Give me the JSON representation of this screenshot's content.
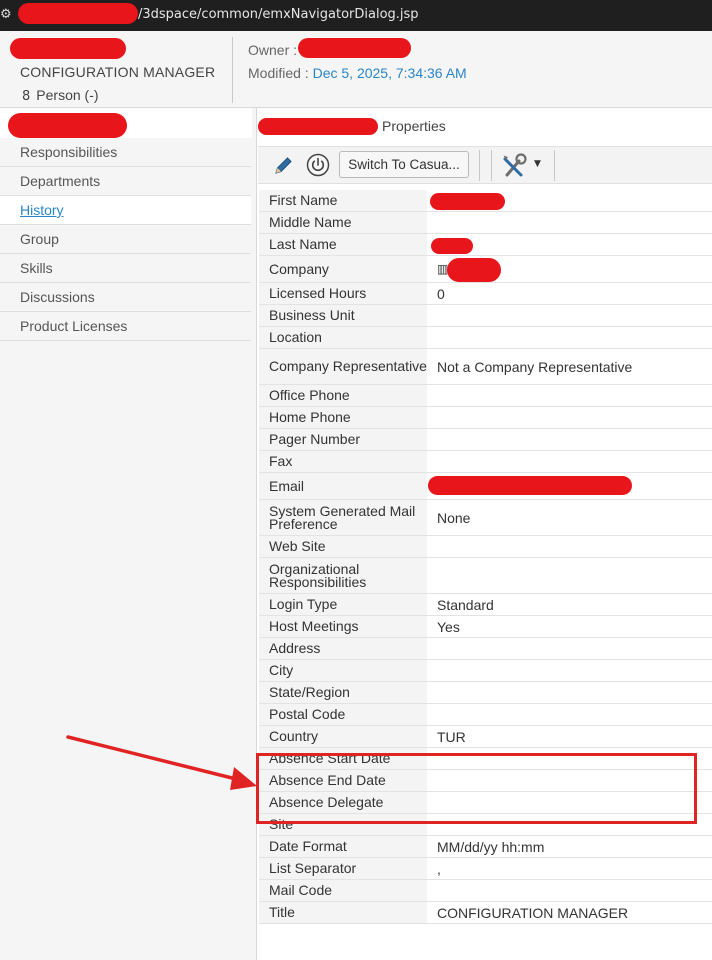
{
  "url_bar": {
    "url": "/3dspace/common/emxNavigatorDialog.jsp"
  },
  "header": {
    "title": "CONFIGURATION MANAGER",
    "type_label": "Person (-)",
    "owner_label": "Owner :",
    "modified_label": "Modified :",
    "modified_value": "Dec 5, 2025, 7:34:36 AM"
  },
  "left_nav": {
    "items": [
      {
        "label": "Responsibilities"
      },
      {
        "label": "Departments"
      },
      {
        "label": "History"
      },
      {
        "label": "Group"
      },
      {
        "label": "Skills"
      },
      {
        "label": "Discussions"
      },
      {
        "label": "Product Licenses"
      }
    ],
    "active_item": "History"
  },
  "main": {
    "title": "Properties",
    "toolbar": {
      "switch_button": "Switch To Casua...",
      "icons": [
        "pencil-icon",
        "power-icon",
        "tools-icon"
      ]
    },
    "properties": [
      {
        "label": "First Name",
        "value": ""
      },
      {
        "label": "Middle Name",
        "value": ""
      },
      {
        "label": "Last Name",
        "value": ""
      },
      {
        "label": "Company",
        "value": ""
      },
      {
        "label": "Licensed Hours",
        "value": "0"
      },
      {
        "label": "Business Unit",
        "value": ""
      },
      {
        "label": "Location",
        "value": ""
      },
      {
        "label": "Company Representative",
        "value": "Not a Company Representative"
      },
      {
        "label": "Office Phone",
        "value": ""
      },
      {
        "label": "Home Phone",
        "value": ""
      },
      {
        "label": "Pager Number",
        "value": ""
      },
      {
        "label": "Fax",
        "value": ""
      },
      {
        "label": "Email",
        "value": ""
      },
      {
        "label": "System Generated Mail Preference",
        "value": "None"
      },
      {
        "label": "Web Site",
        "value": ""
      },
      {
        "label": "Organizational Responsibilities",
        "value": ""
      },
      {
        "label": "Login Type",
        "value": "Standard"
      },
      {
        "label": "Host Meetings",
        "value": "Yes"
      },
      {
        "label": "Address",
        "value": ""
      },
      {
        "label": "City",
        "value": ""
      },
      {
        "label": "State/Region",
        "value": ""
      },
      {
        "label": "Postal Code",
        "value": ""
      },
      {
        "label": "Country",
        "value": "TUR"
      },
      {
        "label": "Absence Start Date",
        "value": ""
      },
      {
        "label": "Absence End Date",
        "value": ""
      },
      {
        "label": "Absence Delegate",
        "value": ""
      },
      {
        "label": "Site",
        "value": ""
      },
      {
        "label": "Date Format",
        "value": "MM/dd/yy hh:mm"
      },
      {
        "label": "List Separator",
        "value": ","
      },
      {
        "label": "Mail Code",
        "value": ""
      },
      {
        "label": "Title",
        "value": "CONFIGURATION MANAGER"
      }
    ]
  },
  "annotation": {
    "color": "#e02424",
    "highlighted": [
      "Absence Start Date",
      "Absence End Date",
      "Absence Delegate"
    ]
  },
  "colors": {
    "link": "#2a85c8",
    "redaction": "#e8151b",
    "label_bg": "#f4f4f4",
    "nav_bg": "#f5f5f5"
  }
}
